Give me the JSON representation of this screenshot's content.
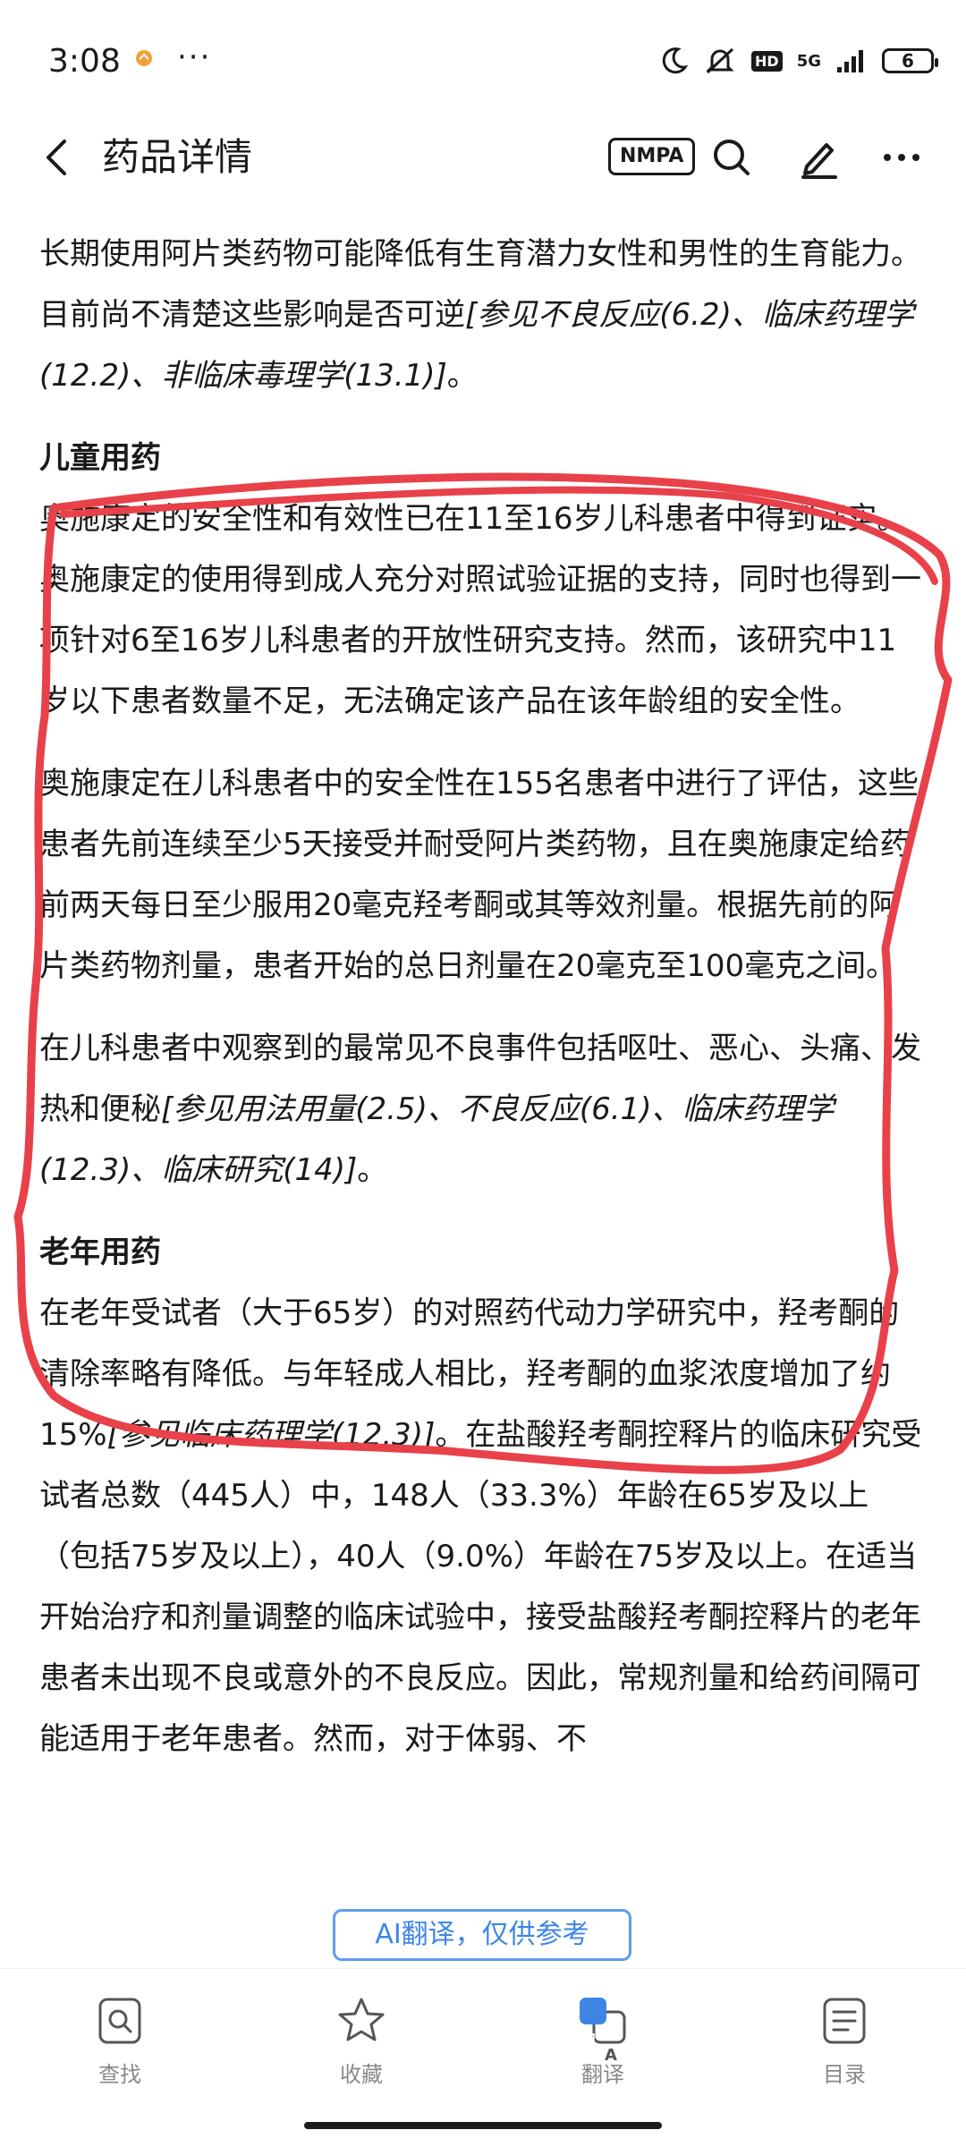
{
  "status_bar": {
    "time": "3:08",
    "dots": "···",
    "network": "5G",
    "hd": "HD",
    "battery": "6"
  },
  "header": {
    "title": "药品详情",
    "nmpa_label": "NMPA"
  },
  "content": {
    "p_intro": {
      "text": "长期使用阿片类药物可能降低有生育潜力女性和男性的生育能力。目前尚不清楚这些影响是否可逆",
      "ref": "[参见不良反应(6.2)、临床药理学(12.2)、非临床毒理学(13.1)]",
      "end": "。"
    },
    "pediatric": {
      "heading": "儿童用药",
      "p1": "奥施康定的安全性和有效性已在11至16岁儿科患者中得到证实。奥施康定的使用得到成人充分对照试验证据的支持，同时也得到一项针对6至16岁儿科患者的开放性研究支持。然而，该研究中11岁以下患者数量不足，无法确定该产品在该年龄组的安全性。",
      "p2": "奥施康定在儿科患者中的安全性在155名患者中进行了评估，这些患者先前连续至少5天接受并耐受阿片类药物，且在奥施康定给药前两天每日至少服用20毫克羟考酮或其等效剂量。根据先前的阿片类药物剂量，患者开始的总日剂量在20毫克至100毫克之间。",
      "p3": {
        "text": "在儿科患者中观察到的最常见不良事件包括呕吐、恶心、头痛、发热和便秘",
        "ref": "[参见用法用量(2.5)、不良反应(6.1)、临床药理学(12.3)、临床研究(14)]",
        "end": "。"
      }
    },
    "geriatric": {
      "heading": "老年用药",
      "p1_a": "在老年受试者（大于65岁）的对照药代动力学研究中，羟考酮的清除率略有降低。与年轻成人相比，羟考酮的血浆浓度增加了约15%",
      "p1_ref": "[参见临床药理学(12.3)]",
      "p1_b": "。在盐酸羟考酮控释片的临床研究受试者总数（445人）中，148人（33.3%）年龄在65岁及以上（包括75岁及以上），40人（9.0%）年龄在75岁及以上。在适当开始治疗和剂量调整的临床试验中，接受盐酸羟考酮控释片的老年患者未出现不良或意外的不良反应。因此，常规剂量和给药间隔可能适用于老年患者。然而，对于体弱、不"
    }
  },
  "ai_badge": "AI翻译，仅供参考",
  "bottom_nav": [
    {
      "label": "查找",
      "icon": "search-doc-icon"
    },
    {
      "label": "收藏",
      "icon": "star-icon"
    },
    {
      "label": "翻译",
      "icon": "translate-icon",
      "badge": "中",
      "badge_sub": "A"
    },
    {
      "label": "目录",
      "icon": "toc-icon"
    }
  ],
  "colors": {
    "annotation": "#e8414a",
    "accent_blue": "#3d86e6"
  }
}
